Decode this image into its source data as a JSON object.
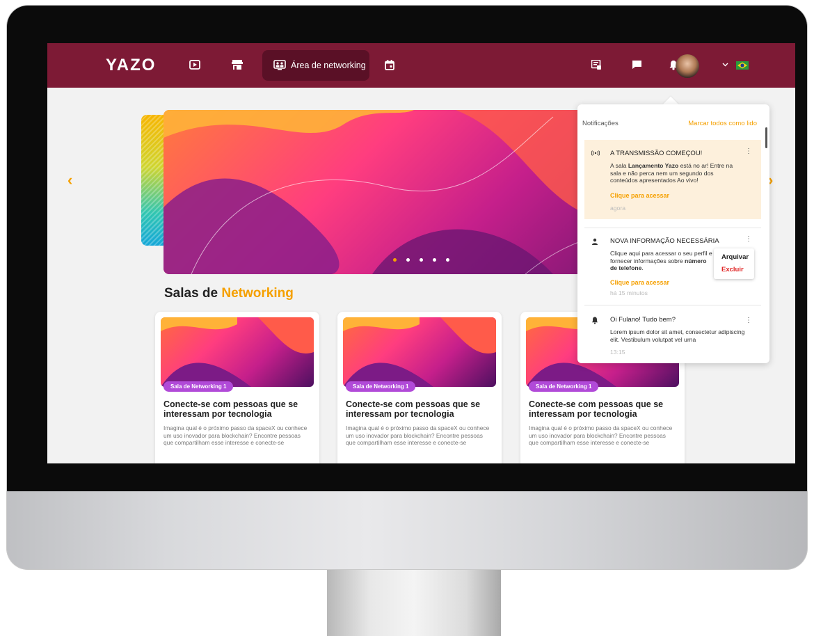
{
  "nav": {
    "logo": "YAZO",
    "active_tab": "Área de networking",
    "icons": [
      "play-icon",
      "store-icon",
      "networking-icon",
      "calendar-icon",
      "badge-icon",
      "chat-icon",
      "bell-icon",
      "chevron-down-icon",
      "brazil-flag-icon"
    ]
  },
  "carousel": {
    "active_dot": 0,
    "dot_count": 5
  },
  "section": {
    "title_prefix": "Salas de",
    "title_highlight": "Networking"
  },
  "cards": [
    {
      "badge": "Sala de Networking 1",
      "title": "Conecte-se com pessoas que se interessam por tecnologia",
      "desc": "Imagina qual é o próximo passo da spaceX ou conhece um uso inovador para blockchain? Encontre pessoas que compartilham esse interesse e conecte-se"
    },
    {
      "badge": "Sala de Networking 1",
      "title": "Conecte-se com pessoas que se interessam por tecnologia",
      "desc": "Imagina qual é o próximo passo da spaceX ou conhece um uso inovador para blockchain? Encontre pessoas que compartilham esse interesse e conecte-se"
    },
    {
      "badge": "Sala de Networking 1",
      "title": "Conecte-se com pessoas que se interessam por tecnologia",
      "desc": "Imagina qual é o próximo passo da spaceX ou conhece um uso inovador para blockchain? Encontre pessoas que compartilham esse interesse e conecte-se"
    }
  ],
  "notifications": {
    "header": "Notificações",
    "mark_all": "Marcar todos como lido",
    "items": [
      {
        "title": "A TRANSMISSÃO COMEÇOU!",
        "body_pre": "A sala ",
        "body_bold": "Lançamento Yazo",
        "body_post": " está no ar! Entre na sala e não perca nem um segundo dos conteúdos apresentados Ao vivo!",
        "link": "Clique para acessar",
        "time": "agora"
      },
      {
        "title": "NOVA INFORMAÇÃO NECESSÁRIA",
        "body_pre": "Clique aqui para acessar o seu perfil e fornecer informações sobre ",
        "body_bold": "número de telefone",
        "body_post": ".",
        "link": "Clique para acessar",
        "time": "há 15 minutos"
      },
      {
        "title": "Oi Fulano! Tudo bem?",
        "body": "Lorem ipsum dolor sit amet, consectetur adipiscing elit. Vestibulum volutpat vel urna",
        "time": "13:15"
      }
    ],
    "context_menu": {
      "archive": "Arquivar",
      "delete": "Excluir"
    }
  },
  "colors": {
    "nav_bg": "#7d1a35",
    "accent": "#f5a000",
    "badge": "#b14ad8",
    "danger": "#e02424"
  }
}
